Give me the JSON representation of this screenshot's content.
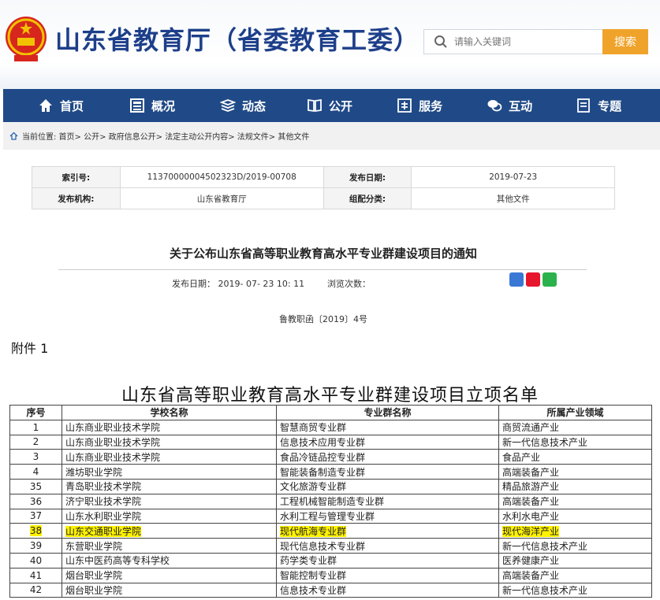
{
  "header": {
    "site_title": "山东省教育厅（省委教育工委）",
    "search_placeholder": "请输入关键词",
    "search_button": "搜索"
  },
  "nav": [
    {
      "label": "首页",
      "icon": "home-icon"
    },
    {
      "label": "概况",
      "icon": "overview-icon"
    },
    {
      "label": "动态",
      "icon": "news-icon"
    },
    {
      "label": "公开",
      "icon": "book-icon"
    },
    {
      "label": "服务",
      "icon": "service-icon"
    },
    {
      "label": "互动",
      "icon": "chat-icon"
    },
    {
      "label": "专题",
      "icon": "topic-icon"
    }
  ],
  "breadcrumb": "当前位置: 首页> 公开> 政府信息公开> 法定主动公开内容> 法规文件> 其他文件",
  "meta": {
    "index_label": "索引号:",
    "index_value": "11370000004502323D/2019-00708",
    "date_label": "发布日期:",
    "date_value": "2019-07-23",
    "org_label": "发布机构:",
    "org_value": "山东省教育厅",
    "category_label": "组配分类:",
    "category_value": "其他文件"
  },
  "article": {
    "title": "关于公布山东省高等职业教育高水平专业群建设项目的通知",
    "publish_time": "发布日期： 2019- 07- 23 10: 11",
    "views_label": "浏览次数：",
    "doc_number": "鲁教职函〔2019〕4号",
    "attachment": "附件 1",
    "list_title": "山东省高等职业教育高水平专业群建设项目立项名单"
  },
  "table": {
    "headers": [
      "序号",
      "学校名称",
      "专业群名称",
      "所属产业领域"
    ],
    "rows": [
      {
        "no": "1",
        "school": "山东商业职业技术学院",
        "group": "智慧商贸专业群",
        "field": "商贸流通产业",
        "highlight": false
      },
      {
        "no": "2",
        "school": "山东商业职业技术学院",
        "group": "信息技术应用专业群",
        "field": "新一代信息技术产业",
        "highlight": false
      },
      {
        "no": "3",
        "school": "山东商业职业技术学院",
        "group": "食品冷链品控专业群",
        "field": "食品产业",
        "highlight": false
      },
      {
        "no": "4",
        "school": "潍坊职业学院",
        "group": "智能装备制造专业群",
        "field": "高端装备产业",
        "highlight": false
      },
      {
        "no": "35",
        "school": "青岛职业技术学院",
        "group": "文化旅游专业群",
        "field": "精品旅游产业",
        "highlight": false
      },
      {
        "no": "36",
        "school": "济宁职业技术学院",
        "group": "工程机械智能制造专业群",
        "field": "高端装备产业",
        "highlight": false
      },
      {
        "no": "37",
        "school": "山东水利职业学院",
        "group": "水利工程与管理专业群",
        "field": "水利水电产业",
        "highlight": false
      },
      {
        "no": "38",
        "school": "山东交通职业学院",
        "group": "现代航海专业群",
        "field": "现代海洋产业",
        "highlight": true
      },
      {
        "no": "39",
        "school": "东营职业学院",
        "group": "现代信息技术专业群",
        "field": "新一代信息技术产业",
        "highlight": false
      },
      {
        "no": "40",
        "school": "山东中医药高等专科学校",
        "group": "药学类专业群",
        "field": "医养健康产业",
        "highlight": false
      },
      {
        "no": "41",
        "school": "烟台职业学院",
        "group": "智能控制专业群",
        "field": "高端装备产业",
        "highlight": false
      },
      {
        "no": "42",
        "school": "烟台职业学院",
        "group": "信息技术专业群",
        "field": "新一代信息技术产业",
        "highlight": false
      }
    ]
  }
}
